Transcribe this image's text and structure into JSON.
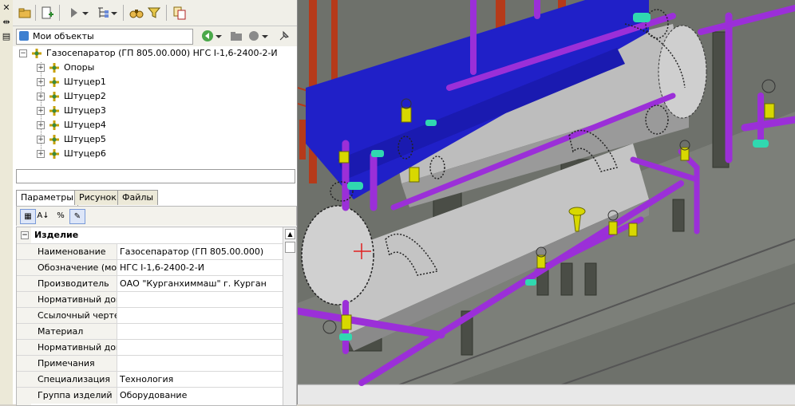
{
  "favorites": {
    "label": "Мои объекты"
  },
  "tree": {
    "root": "Газосепаратор (ГП 805.00.000) НГС I-1,6-2400-2-И",
    "children": [
      "Опоры",
      "Штуцер1",
      "Штуцер2",
      "Штуцер3",
      "Штуцер4",
      "Штуцер5",
      "Штуцер6"
    ]
  },
  "tabs": [
    "Параметры",
    "Рисунок",
    "Файлы"
  ],
  "properties": {
    "group": "Изделие",
    "rows": [
      {
        "key": "Наименование",
        "value": "Газосепаратор (ГП 805.00.000)"
      },
      {
        "key": "Обозначение (модель)",
        "value": "НГС I-1,6-2400-2-И"
      },
      {
        "key": "Производитель",
        "value": "ОАО \"Курганхиммаш\" г. Курган"
      },
      {
        "key": "Нормативный документ",
        "value": ""
      },
      {
        "key": "Ссылочный чертеж",
        "value": ""
      },
      {
        "key": "Материал",
        "value": ""
      },
      {
        "key": "Нормативный докуме...",
        "value": ""
      },
      {
        "key": "Примечания",
        "value": ""
      },
      {
        "key": "Специализация",
        "value": "Технология"
      },
      {
        "key": "Группа изделий",
        "value": "Оборудование"
      }
    ]
  },
  "colors": {
    "pipe": "#9b2fd8",
    "platform": "#2020c8",
    "steel": "#b53a1a",
    "vessel": "#c4c4c4",
    "valve": "#d8d800",
    "flange": "#30d8b0"
  }
}
